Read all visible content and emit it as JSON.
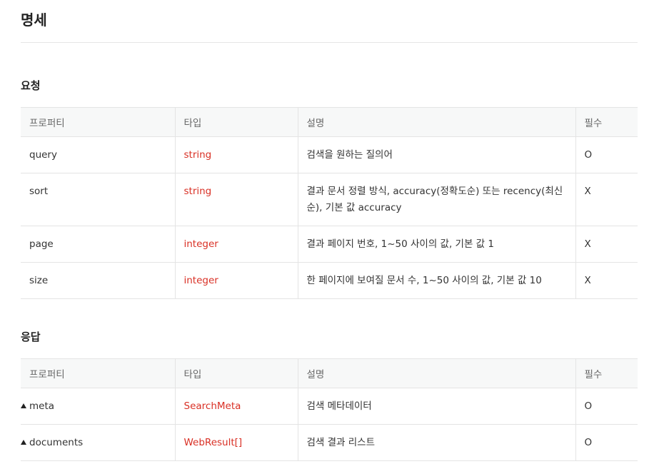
{
  "page": {
    "title": "명세"
  },
  "request": {
    "title": "요청",
    "headers": [
      "프로퍼티",
      "타입",
      "설명",
      "필수"
    ],
    "rows": [
      {
        "property": "query",
        "type": "string",
        "description": "검색을 원하는 질의어",
        "required": "O"
      },
      {
        "property": "sort",
        "type": "string",
        "description": "결과 문서 정렬 방식, accuracy(정확도순) 또는 recency(최신순), 기본 값 accuracy",
        "required": "X"
      },
      {
        "property": "page",
        "type": "integer",
        "description": "결과 페이지 번호, 1~50 사이의 값, 기본 값 1",
        "required": "X"
      },
      {
        "property": "size",
        "type": "integer",
        "description": "한 페이지에 보여질 문서 수, 1~50 사이의 값, 기본 값 10",
        "required": "X"
      }
    ]
  },
  "response": {
    "title": "응답",
    "headers": [
      "프로퍼티",
      "타입",
      "설명",
      "필수"
    ],
    "rows": [
      {
        "property": "meta",
        "type": "SearchMeta",
        "description": "검색 메타데이터",
        "required": "O",
        "icon": "caret-up-icon"
      },
      {
        "property": "documents",
        "type": "WebResult[]",
        "description": "검색 결과 리스트",
        "required": "O",
        "icon": "caret-up-icon"
      }
    ]
  },
  "colors": {
    "type_text": "#d93025",
    "header_bg": "#f7f8f8",
    "border": "#e4e4e4"
  }
}
